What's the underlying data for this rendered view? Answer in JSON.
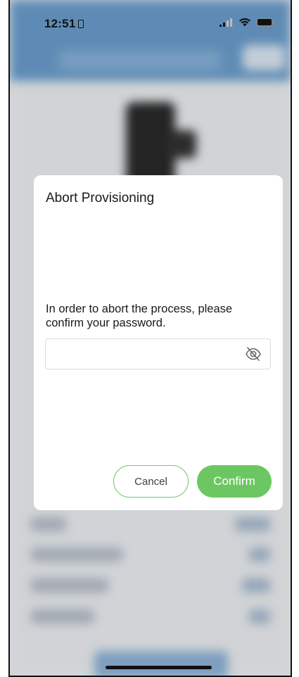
{
  "status_bar": {
    "time": "12:51"
  },
  "dialog": {
    "title": "Abort Provisioning",
    "message": "In order to abort the process, please confirm your password.",
    "password": {
      "value": "",
      "placeholder": "",
      "toggle_icon": "eye-off-icon"
    },
    "cancel_label": "Cancel",
    "confirm_label": "Confirm"
  },
  "colors": {
    "accent_green": "#6cc762",
    "header_blue": "#6c9fcf"
  }
}
